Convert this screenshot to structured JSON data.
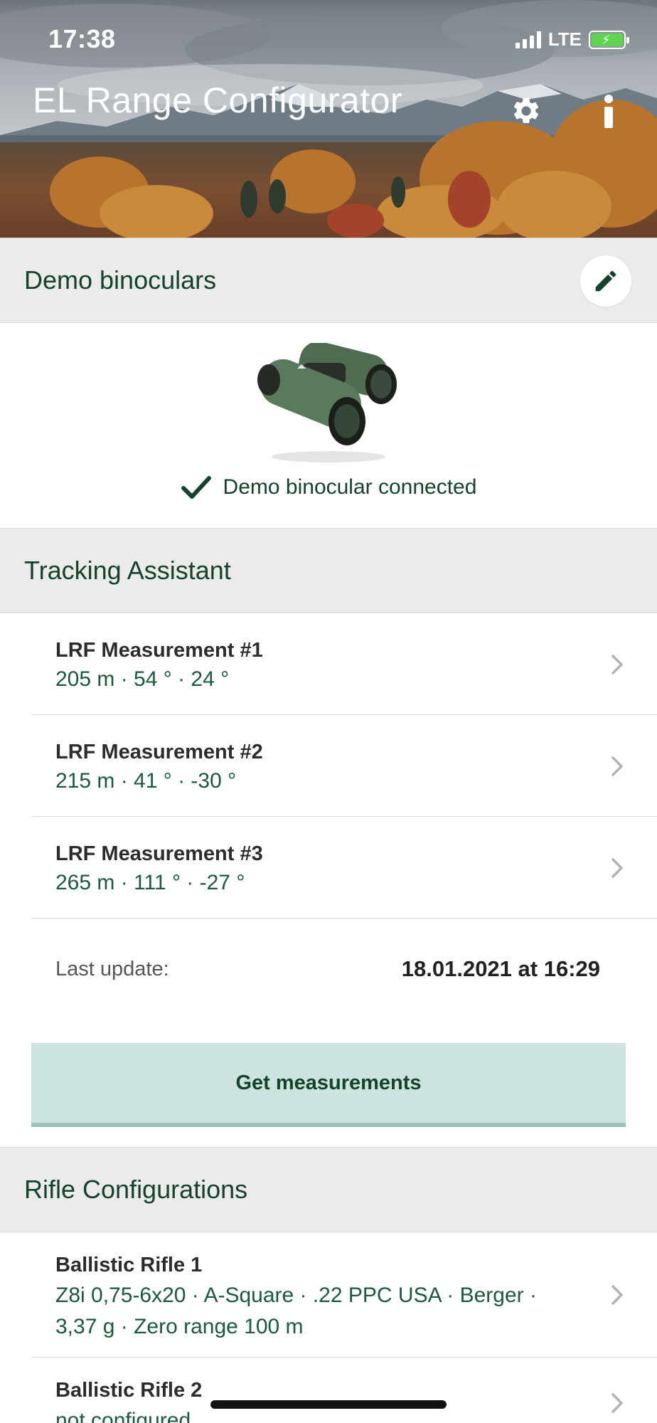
{
  "status_bar": {
    "time": "17:38",
    "network": "LTE"
  },
  "header": {
    "title": "EL Range Configurator",
    "settings_icon": "gear-icon",
    "info_icon": "info-icon"
  },
  "device": {
    "name": "Demo binoculars",
    "edit_icon": "pencil-icon",
    "status_icon": "checkmark-icon",
    "status_text": "Demo binocular connected"
  },
  "tracking": {
    "section_title": "Tracking Assistant",
    "measurements": [
      {
        "title": "LRF Measurement #1",
        "details": "205 m · 54 ° · 24 °"
      },
      {
        "title": "LRF Measurement #2",
        "details": "215 m · 41 ° · -30 °"
      },
      {
        "title": "LRF Measurement #3",
        "details": "265 m · 111 ° · -27 °"
      }
    ],
    "last_update_label": "Last update:",
    "last_update_value": "18.01.2021 at 16:29",
    "get_button_label": "Get measurements"
  },
  "rifles": {
    "section_title": "Rifle Configurations",
    "items": [
      {
        "title": "Ballistic Rifle 1",
        "details_line1": "Z8i 0,75-6x20 · A-Square · .22 PPC USA · Berger ·",
        "details_line2": "3,37 g · Zero range 100 m"
      },
      {
        "title": "Ballistic Rifle 2",
        "details_line1": "not configured"
      }
    ]
  },
  "colors": {
    "brand_green": "#15432a",
    "accent_green_text": "#1b5a3a",
    "button_bg": "#cde3df",
    "section_bg": "#ebebeb"
  }
}
